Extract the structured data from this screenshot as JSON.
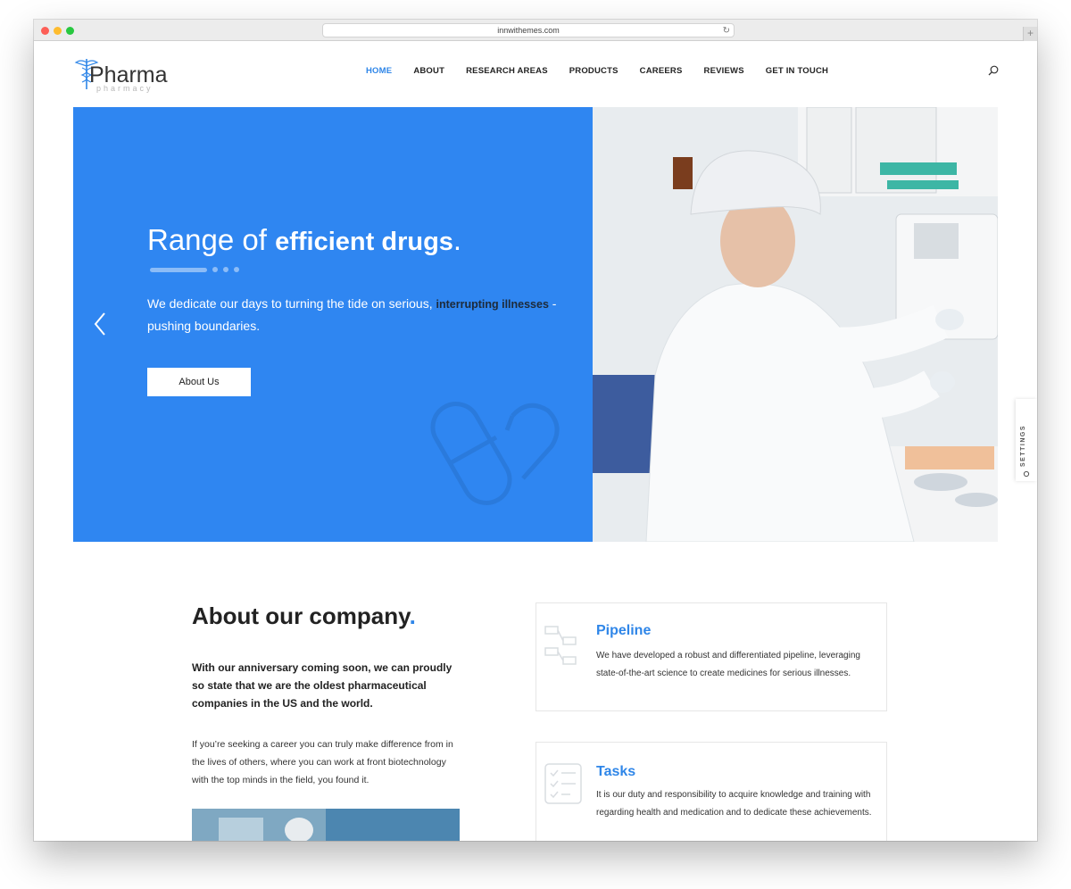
{
  "browser": {
    "url": "innwithemes.com"
  },
  "logo": {
    "name": "Pharma",
    "subtitle": "pharmacy"
  },
  "nav": {
    "items": [
      "HOME",
      "ABOUT",
      "RESEARCH AREAS",
      "PRODUCTS",
      "CAREERS",
      "REVIEWS",
      "GET IN TOUCH"
    ],
    "active": "HOME"
  },
  "hero": {
    "title_light": "Range of ",
    "title_bold": "efficient drugs",
    "title_dot": ".",
    "text_before": "We dedicate our days to turning the tide on serious, ",
    "text_highlight": "interrupting illnesses",
    "text_after": " - pushing boundaries.",
    "button_label": "About Us"
  },
  "settings": {
    "label": "SETTINGS"
  },
  "about": {
    "title": "About our company",
    "title_dot": ".",
    "lead": "With our anniversary coming soon, we can proudly so state that we are the oldest pharmaceutical companies in the US and the world.",
    "body": "If you’re seeking a career you can truly make difference from in the lives of others, where you can work at front biotechnology with the top minds in the field, you found it."
  },
  "cards": [
    {
      "title": "Pipeline",
      "body": "We have developed a robust and differentiated pipeline, leveraging state-of-the-art science to create medicines for serious illnesses."
    },
    {
      "title": "Tasks",
      "body": "It is our duty and responsibility to acquire knowledge and training with regarding health and medication and to dedicate these achievements."
    }
  ],
  "colors": {
    "accent": "#2f86e8",
    "hero_bg": "#2f86f1",
    "text": "#222222"
  }
}
